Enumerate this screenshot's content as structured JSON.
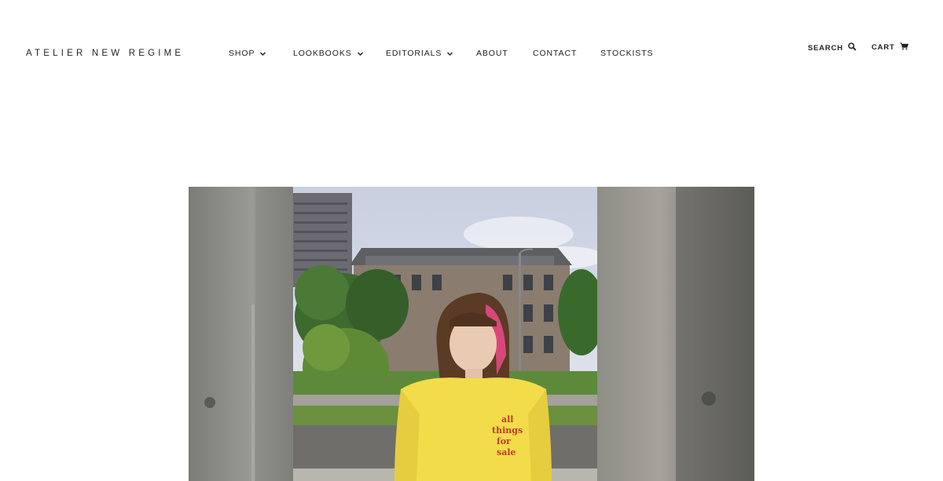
{
  "brand": {
    "name": "ATELIER NEW REGIME"
  },
  "nav": {
    "items": [
      {
        "label": "SHOP",
        "has_dropdown": true
      },
      {
        "label": "LOOKBOOKS",
        "has_dropdown": true
      },
      {
        "label": "EDITORIALS",
        "has_dropdown": true
      },
      {
        "label": "ABOUT",
        "has_dropdown": false
      },
      {
        "label": "CONTACT",
        "has_dropdown": false
      },
      {
        "label": "STOCKISTS",
        "has_dropdown": false
      }
    ]
  },
  "utility": {
    "search_label": "SEARCH",
    "search_icon": "search-icon",
    "cart_label": "CART",
    "cart_icon": "cart-icon"
  },
  "hero": {
    "shirt_text": [
      "all",
      "things",
      "for",
      "sale"
    ]
  },
  "colors": {
    "background": "#ffffff",
    "text": "#222222",
    "shirt_yellow": "#f2dc4a",
    "shirt_print_red": "#c0392b"
  }
}
